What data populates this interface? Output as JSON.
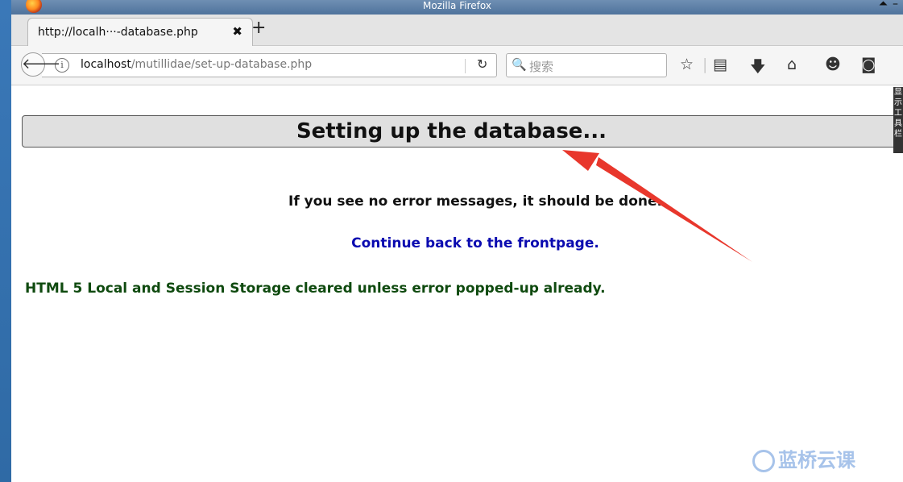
{
  "window": {
    "title": "Mozilla Firefox"
  },
  "tabs": [
    {
      "title": "http://localh···-database.php",
      "close": "✖"
    }
  ],
  "newtab": "+",
  "url": {
    "host": "localhost",
    "path": "/mutillidae/set-up-database.php"
  },
  "search": {
    "placeholder": "搜索"
  },
  "page": {
    "heading": "Setting up the database...",
    "message": "If you see no error messages, it should be done.",
    "link": "Continue back to the frontpage.",
    "storage_message": "HTML 5 Local and Session Storage cleared unless error popped-up already."
  },
  "side_tooltip": "显示工具栏",
  "watermark": "蓝桥云课",
  "colors": {
    "link": "#0b0bb0",
    "storage_message": "#0f4a0f",
    "arrow": "#e8372c"
  }
}
